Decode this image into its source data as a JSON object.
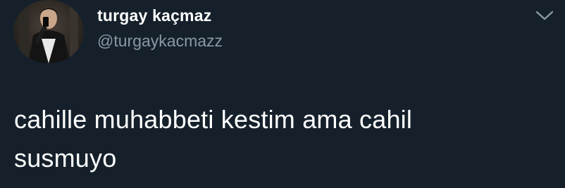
{
  "author": {
    "display_name": "turgay kaçmaz",
    "handle": "@turgaykacmazz",
    "avatar_icon": "profile-photo"
  },
  "tweet": {
    "text_lines": [
      "cahille muhabbeti kestim ama cahil",
      "susmuyo"
    ]
  },
  "menu": {
    "icon": "chevron-down-icon"
  },
  "colors": {
    "background": "#15202b",
    "text": "#ffffff",
    "secondary": "#8899a6"
  }
}
